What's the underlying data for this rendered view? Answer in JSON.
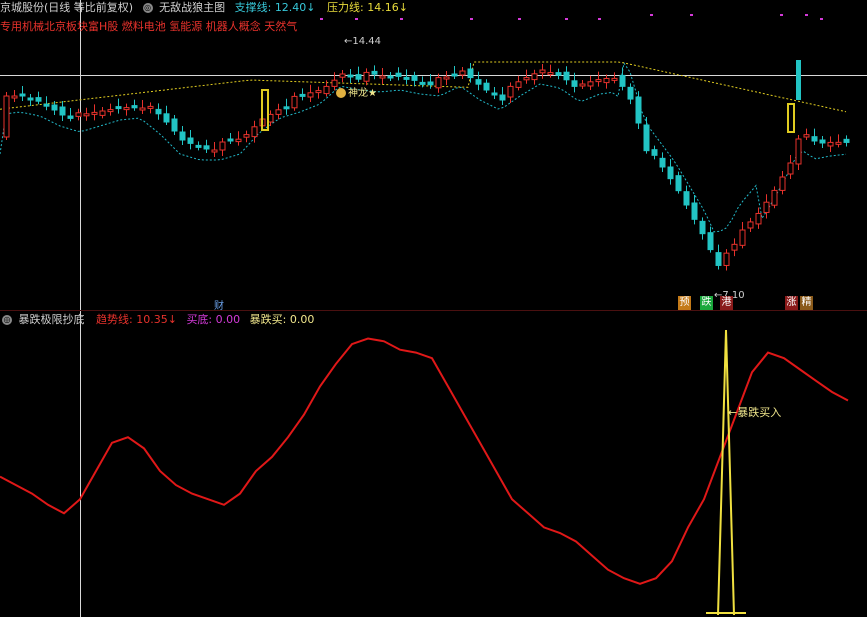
{
  "header": {
    "stock_name": "京城股份(日线 等比前复权)",
    "indicator_name": "无敌战狼主图",
    "support_label": "支撑线:",
    "support_value": "12.40↓",
    "pressure_label": "压力线:",
    "pressure_value": "14.16↓",
    "concepts": "专用机械北京板块富H股 燃料电池 氢能源 机器人概念 天然气"
  },
  "annotations": {
    "high": "14.44",
    "low": "7.10",
    "dragon": "神龙★",
    "cai": "财",
    "tags": [
      "预",
      "跌",
      "港",
      "涨",
      "精"
    ],
    "crash_buy": "←暴跌买入"
  },
  "sub_header": {
    "name": "暴跌极限抄底",
    "trend_label": "趋势线:",
    "trend_value": "10.35↓",
    "buy_label": "买底:",
    "buy_value": "0.00",
    "crash_label": "暴跌买:",
    "crash_value": "0.00"
  },
  "colors": {
    "up": "#e8322c",
    "down": "#22c4c4",
    "ma_cyan": "#22b8c8",
    "ma_yellow": "#e0cc20",
    "trend": "#e01818",
    "crash": "#f0e040",
    "dots": "#d43ad8"
  },
  "chart_data": {
    "type": "line",
    "trend_line": [
      48,
      45,
      42,
      38,
      35,
      40,
      50,
      60,
      62,
      58,
      50,
      45,
      42,
      40,
      38,
      42,
      50,
      55,
      62,
      70,
      80,
      88,
      95,
      97,
      96,
      93,
      92,
      90,
      80,
      70,
      60,
      50,
      40,
      35,
      30,
      28,
      25,
      20,
      15,
      12,
      10,
      12,
      18,
      30,
      40,
      55,
      70,
      85,
      92,
      90,
      86,
      82,
      78,
      75
    ],
    "crash_buy_signal": {
      "index": 46,
      "value": 100
    }
  }
}
